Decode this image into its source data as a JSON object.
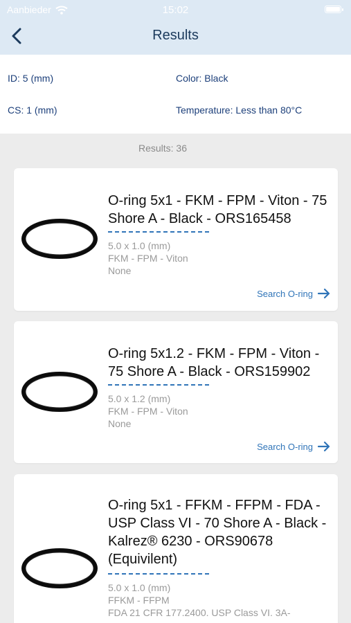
{
  "status_bar": {
    "carrier": "Aanbieder",
    "time": "15:02"
  },
  "nav": {
    "title": "Results"
  },
  "filters": {
    "id": "ID: 5 (mm)",
    "color": "Color: Black",
    "cs": "CS: 1 (mm)",
    "temperature": "Temperature: Less than 80°C"
  },
  "results_count": "Results: 36",
  "products": [
    {
      "title": "O-ring 5x1 - FKM - FPM - Viton - 75 Shore A - Black - ORS165458",
      "dimensions": "5.0 x 1.0 (mm)",
      "material": "FKM - FPM - Viton",
      "certification": "None",
      "action": "Search O-ring"
    },
    {
      "title": "O-ring 5x1.2 - FKM - FPM - Viton - 75 Shore A - Black - ORS159902",
      "dimensions": "5.0 x 1.2 (mm)",
      "material": "FKM - FPM - Viton",
      "certification": "None",
      "action": "Search O-ring"
    },
    {
      "title": "O-ring 5x1 - FFKM - FFPM - FDA - USP Class VI - 70 Shore A - Black - Kalrez® 6230 - ORS90678 (Equivilent)",
      "dimensions": "5.0 x 1.0 (mm)",
      "material": "FFKM - FFPM",
      "certification": "FDA 21 CFR 177.2400. USP Class VI. 3A-"
    }
  ],
  "colors": {
    "header_bg": "#dde9f4",
    "accent": "#2f74b8",
    "title_text": "#1b3a5c"
  }
}
